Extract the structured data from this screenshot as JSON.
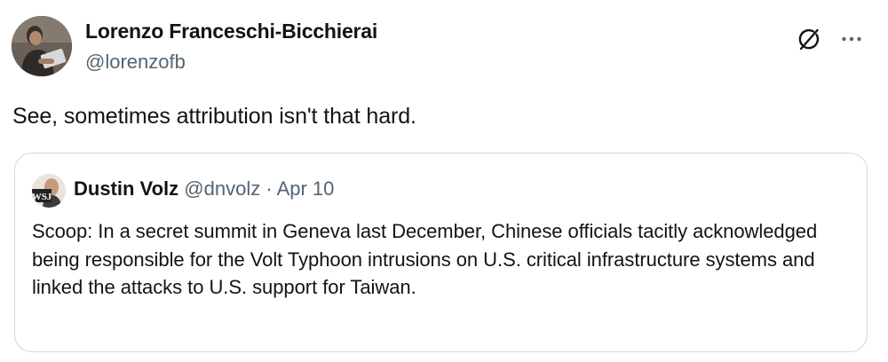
{
  "tweet": {
    "author": {
      "display_name": "Lorenzo Franceschi-Bicchierai",
      "handle": "@lorenzofb"
    },
    "text": "See, sometimes attribution isn't that hard.",
    "actions": {
      "grok_icon": "grok-icon",
      "more_icon": "more-icon",
      "more_glyph": "···"
    }
  },
  "quote": {
    "author": {
      "display_name": "Dustin Volz",
      "handle": "@dnvolz",
      "avatar_label": "WSJ"
    },
    "separator": "·",
    "date": "Apr 10",
    "text": "Scoop: In a secret summit in Geneva last December, Chinese officials tacitly acknowledged being responsible for the Volt Typhoon intrusions on U.S. critical infrastructure systems and linked the attacks to U.S. support for Taiwan."
  },
  "colors": {
    "text_primary": "#0f1419",
    "text_secondary": "#536471",
    "border": "#cfd9de"
  }
}
